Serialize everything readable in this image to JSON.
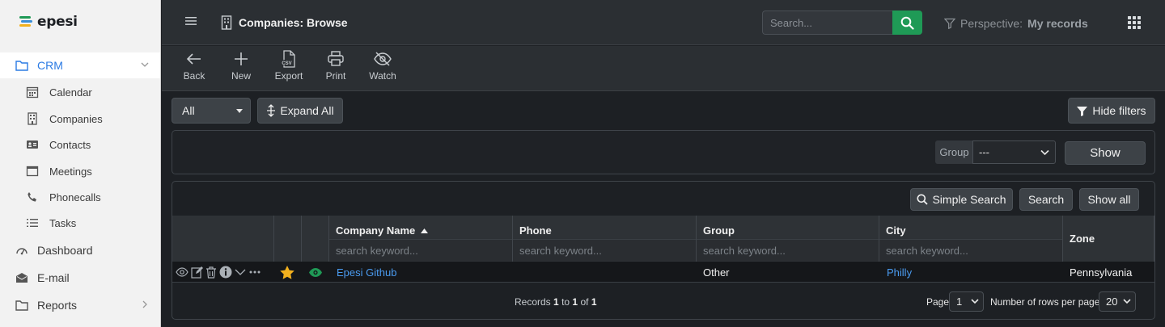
{
  "app": {
    "logo_text": "epesi"
  },
  "sidebar": {
    "crm": {
      "label": "CRM"
    },
    "sub_items": [
      {
        "label": "Calendar",
        "icon": "calendar-icon"
      },
      {
        "label": "Companies",
        "icon": "building-icon"
      },
      {
        "label": "Contacts",
        "icon": "contact-card-icon"
      },
      {
        "label": "Meetings",
        "icon": "meeting-window-icon"
      },
      {
        "label": "Phonecalls",
        "icon": "phone-icon"
      },
      {
        "label": "Tasks",
        "icon": "list-icon"
      }
    ],
    "items": [
      {
        "label": "Dashboard",
        "icon": "gauge-icon"
      },
      {
        "label": "E-mail",
        "icon": "envelope-icon"
      },
      {
        "label": "Reports",
        "icon": "folder-icon"
      }
    ]
  },
  "header": {
    "title": "Companies: Browse",
    "search_placeholder": "Search...",
    "perspective_label": "Perspective:",
    "perspective_value": "My records"
  },
  "toolbar": {
    "back": "Back",
    "new": "New",
    "export": "Export",
    "export_badge": "CSV",
    "print": "Print",
    "watch": "Watch"
  },
  "filters": {
    "select_value": "All",
    "expand_all": "Expand All",
    "hide_filters": "Hide filters",
    "group_label": "Group",
    "group_value": "---",
    "show": "Show"
  },
  "table": {
    "simple_search": "Simple Search",
    "search": "Search",
    "show_all": "Show all",
    "search_keyword_placeholder": "search keyword...",
    "columns": [
      "Company Name",
      "Phone",
      "Group",
      "City",
      "Zone"
    ],
    "rows": [
      {
        "company_name": "Epesi Github",
        "phone": "",
        "group": "Other",
        "city": "Philly",
        "zone": "Pennsylvania",
        "favorite": true,
        "watched": true
      }
    ],
    "footer": {
      "records_prefix": "Records",
      "records_from": "1",
      "records_to_word": "to",
      "records_to": "1",
      "records_of_word": "of",
      "records_total": "1",
      "page_label": "Page",
      "page_value": "1",
      "rows_per_page_label": "Number of rows per page",
      "rows_per_page_value": "20"
    }
  },
  "colors": {
    "accent_green": "#1f9a56",
    "link_blue": "#4a9bf0",
    "active_blue": "#2b7be4",
    "star_yellow": "#f2b01e",
    "eye_green": "#1f9a56"
  }
}
